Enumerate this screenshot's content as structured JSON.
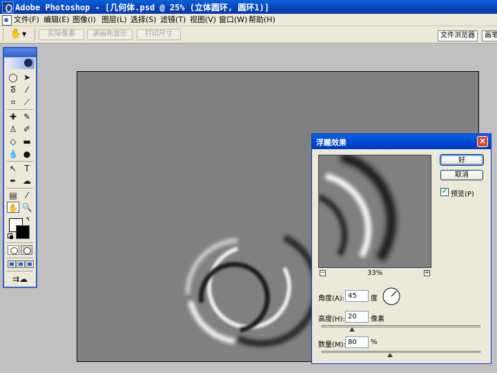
{
  "window": {
    "title": "Adobe Photoshop - [几何体.psd @ 25% (立体圆环, 圆环1)]"
  },
  "menu": {
    "items": [
      "文件(F)",
      "编辑(E)",
      "图像(I)",
      "图层(L)",
      "选择(S)",
      "滤镜(T)",
      "视图(V)",
      "窗口(W)",
      "帮助(H)"
    ]
  },
  "options_bar": {
    "tool_icon": "hand-icon",
    "buttons": [
      "实际像素",
      "满画布显示",
      "打印尺寸"
    ],
    "palette_well_tabs": [
      "文件浏览器",
      "画笔"
    ]
  },
  "toolbox": {
    "tools": [
      "ellipse-marquee",
      "move",
      "lasso",
      "magic-wand",
      "crop",
      "slice",
      "healing-brush",
      "brush",
      "clone-stamp",
      "history-brush",
      "eraser",
      "gradient",
      "blur",
      "dodge",
      "path-selection",
      "type",
      "pen",
      "custom-shape",
      "notes",
      "eyedropper",
      "hand",
      "zoom"
    ],
    "foreground_color": "#ffffff",
    "background_color": "#000000"
  },
  "dialog": {
    "title": "浮雕效果",
    "ok_label": "好",
    "cancel_label": "取消",
    "preview_checked": true,
    "preview_label": "预览(P)",
    "zoom_minus": "−",
    "zoom_plus": "+",
    "zoom": "33%",
    "angle_label": "角度(A):",
    "angle_value": "45",
    "angle_unit": "度",
    "height_label": "高度(H):",
    "height_value": "20",
    "height_unit": "像素",
    "amount_label": "数量(M):",
    "amount_value": "80",
    "amount_unit": "%",
    "height_slider_fraction": 0.19,
    "amount_slider_fraction": 0.43
  },
  "colors": {
    "canvas_gray": "#808080",
    "titlebar_blue": "#0a5fd8",
    "xp_beige": "#ece9d8"
  }
}
